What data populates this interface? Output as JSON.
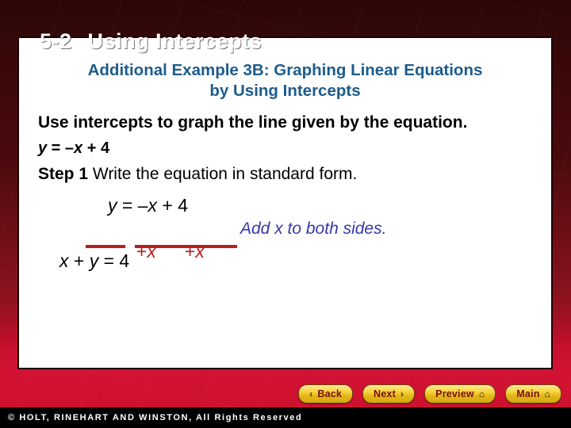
{
  "slide": {
    "number": "5-2",
    "title": "Using Intercepts"
  },
  "content": {
    "example_heading_line1": "Additional Example 3B: Graphing Linear Equations",
    "example_heading_line2": "by Using Intercepts",
    "prompt": "Use intercepts to graph the line given by the equation.",
    "equation_given": "y = –x + 4",
    "step_label": "Step 1",
    "step_text": "Write the equation in standard form.",
    "work": {
      "line1": "y = –x + 4",
      "add_left": "+x",
      "add_right": "+x",
      "result": "x + y = 4",
      "side_note": "Add x to both sides."
    }
  },
  "nav": {
    "back_label": "Back",
    "next_label": "Next",
    "preview_label": "Preview",
    "main_label": "Main",
    "back_icon": "chevron-left-icon",
    "next_icon": "chevron-right-icon",
    "home_icon": "home-icon",
    "chevron_left_glyph": "‹",
    "chevron_right_glyph": "›",
    "home_glyph": "⌂"
  },
  "footer": {
    "copyright": "© HOLT, RINEHART AND WINSTON, All Rights Reserved"
  },
  "colors": {
    "heading_blue": "#1c5c8c",
    "work_red": "#b81d20",
    "note_blue": "#3636ad",
    "band_red": "#c8102e",
    "button_gold": "#f6d33f"
  }
}
